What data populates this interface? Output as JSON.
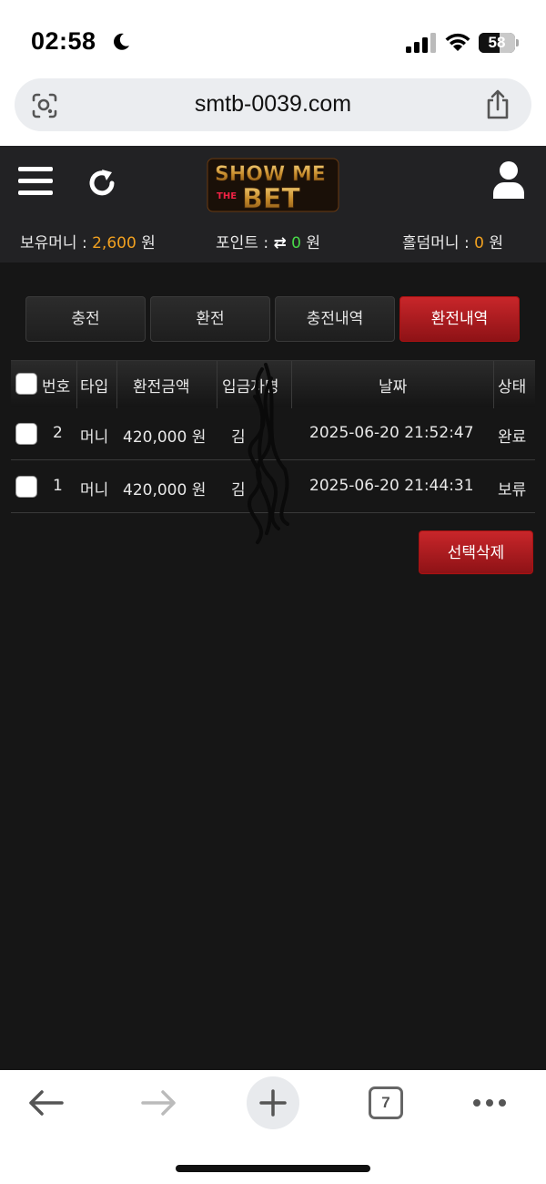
{
  "status_bar": {
    "time": "02:58",
    "battery": "58",
    "battery_fraction": 0.58
  },
  "browser": {
    "url": "smtb-0039.com",
    "tab_count": "7"
  },
  "header": {
    "logo_text_top": "SHOW ME",
    "logo_text_the": "THE",
    "logo_text_bottom": "BET",
    "balances": {
      "money_label": "보유머니 : ",
      "money_value": "2,600",
      "money_unit": " 원",
      "point_label": "포인트 : ",
      "point_swap": "⇄",
      "point_value": "0",
      "point_unit": " 원",
      "holdem_label": "홀덤머니 : ",
      "holdem_value": "0",
      "holdem_unit": " 원"
    }
  },
  "tabs": [
    {
      "label": "충전",
      "active": false
    },
    {
      "label": "환전",
      "active": false
    },
    {
      "label": "충전내역",
      "active": false
    },
    {
      "label": "환전내역",
      "active": true
    }
  ],
  "table": {
    "columns": [
      "번호",
      "타입",
      "환전금액",
      "입금자명",
      "날짜",
      "상태"
    ],
    "rows": [
      {
        "no": "2",
        "type": "머니",
        "amount": "420,000 원",
        "name": "김",
        "date": "2025-06-20 21:52:47",
        "status": "완료"
      },
      {
        "no": "1",
        "type": "머니",
        "amount": "420,000 원",
        "name": "김",
        "date": "2025-06-20 21:44:31",
        "status": "보류"
      }
    ]
  },
  "delete_button": "선택삭제",
  "colors": {
    "accent_red": "#c8262a",
    "money_orange": "#f0a020",
    "point_green": "#48d848"
  }
}
